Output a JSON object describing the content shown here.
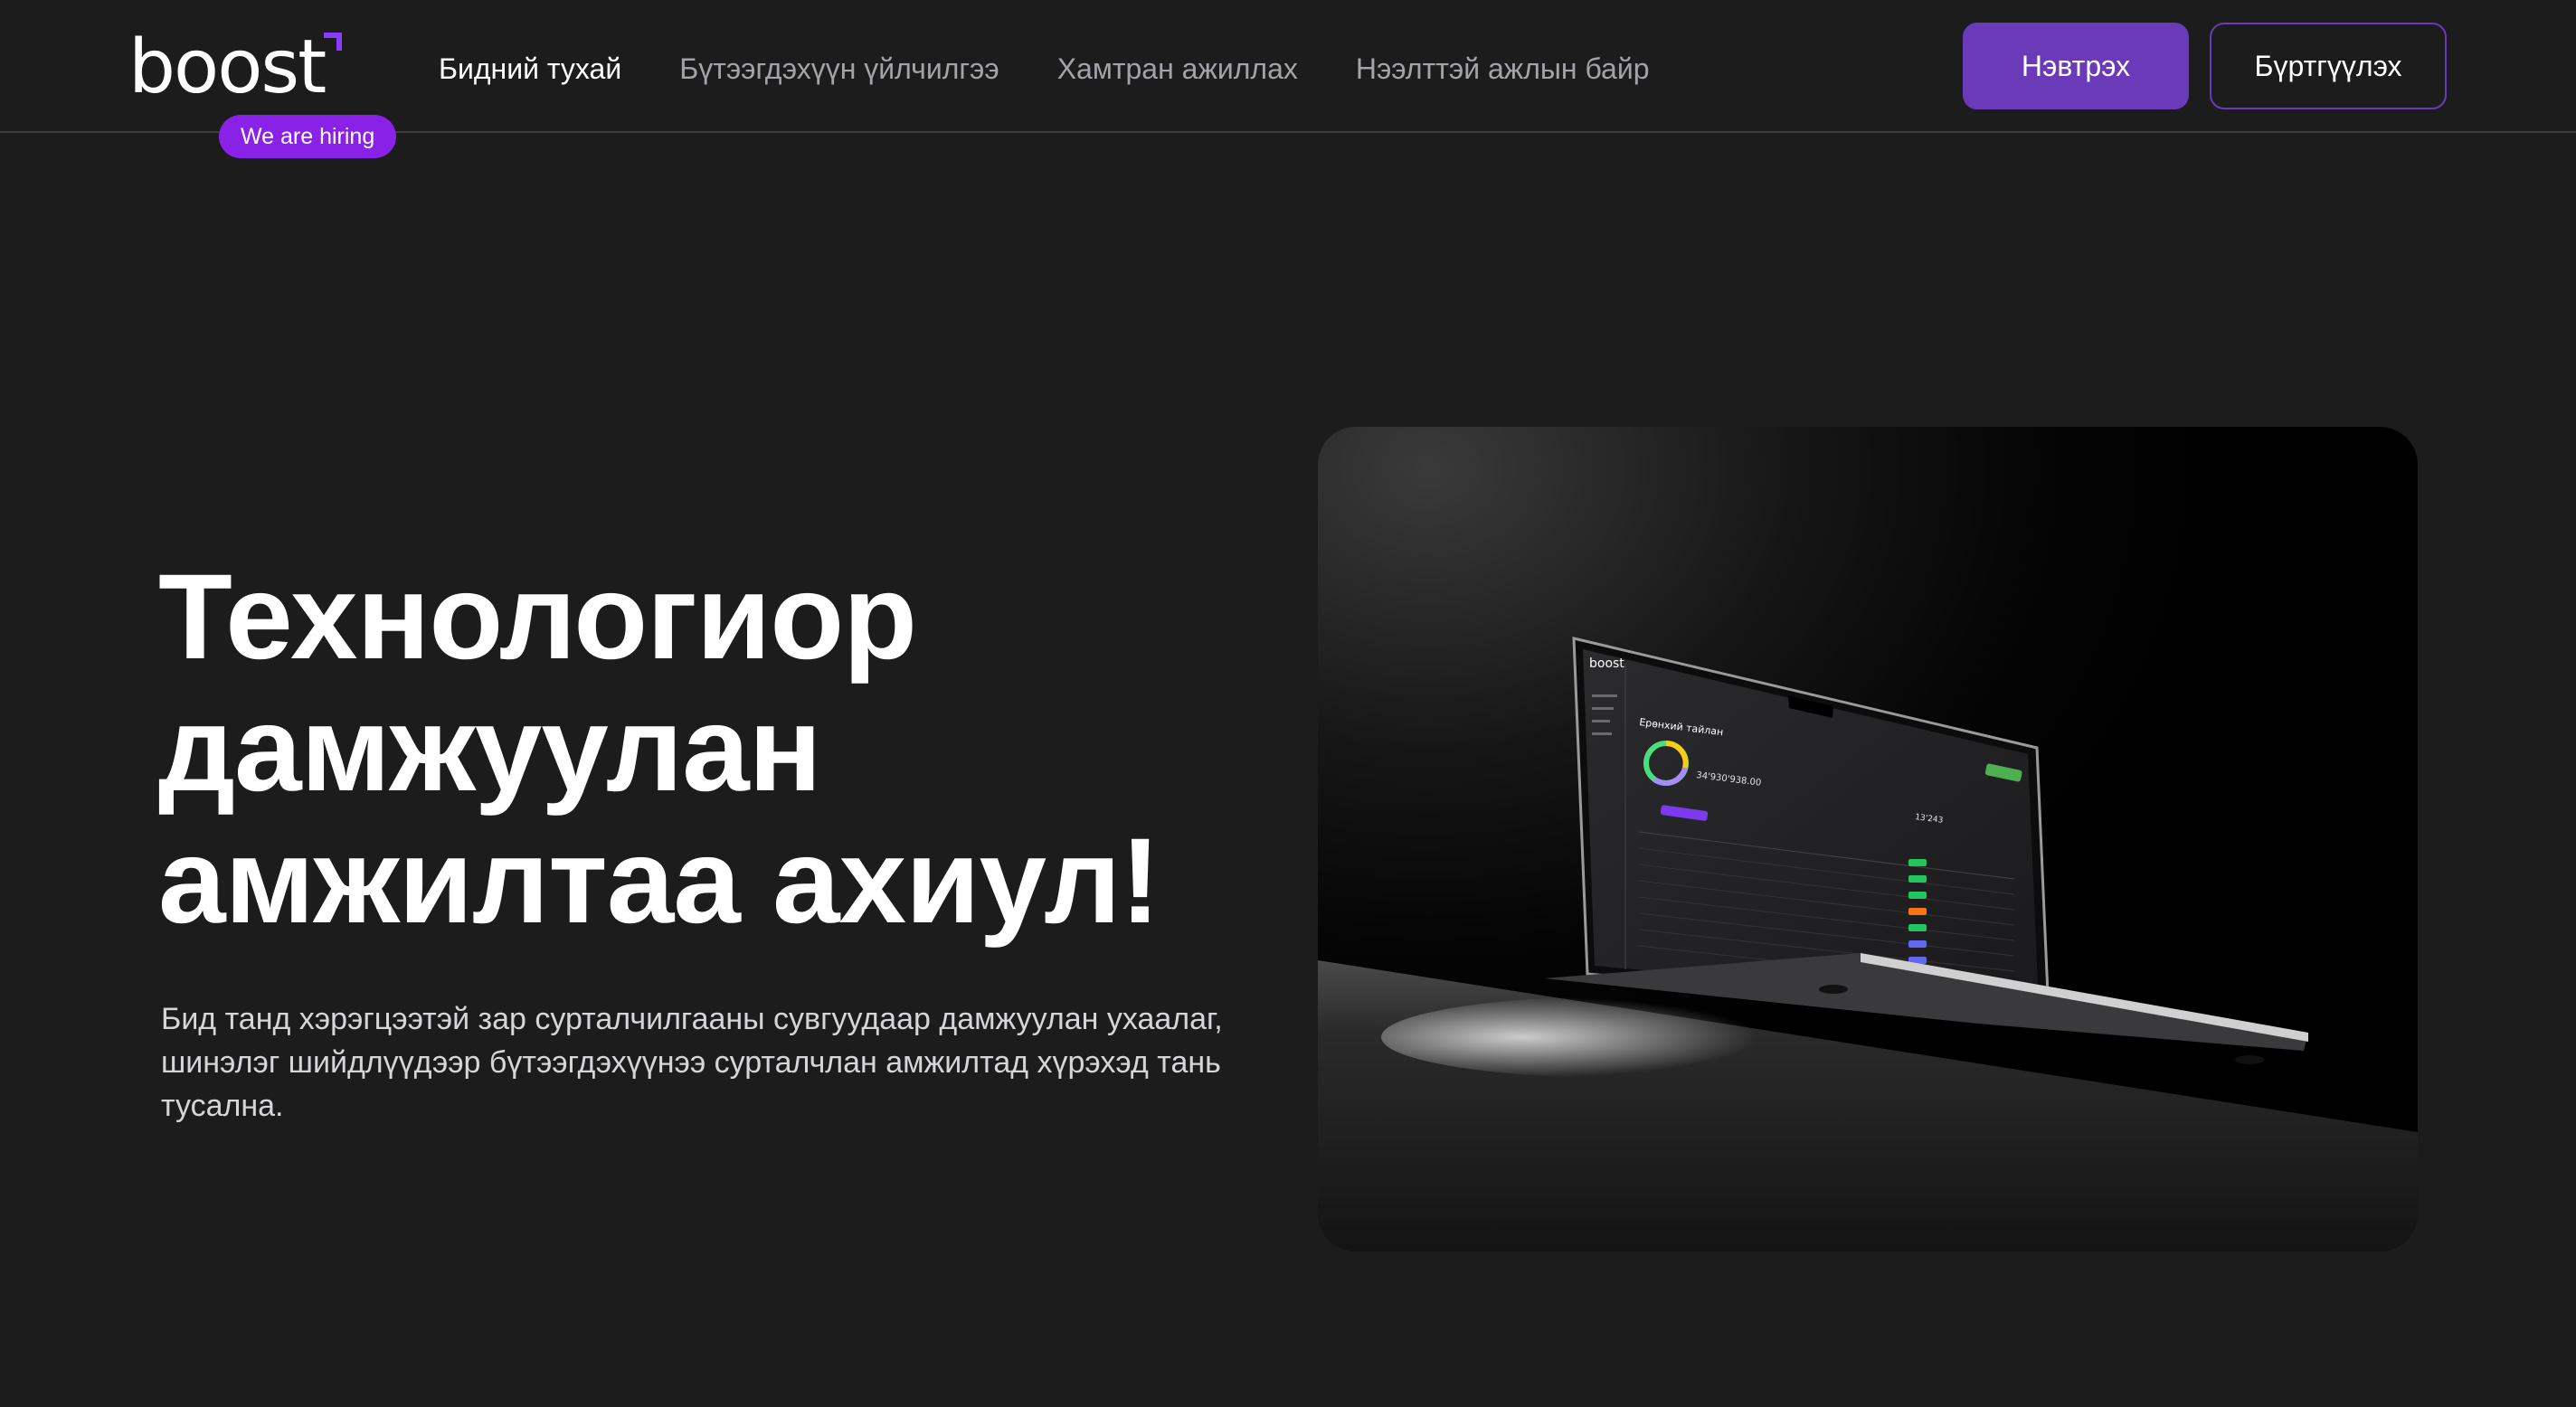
{
  "brand": {
    "logo_text": "boost",
    "hiring_badge": "We are hiring",
    "accent_color": "#6a3ab8",
    "badge_color": "#8a21e6"
  },
  "nav": {
    "items": [
      {
        "label": "Бидний тухай",
        "active": true
      },
      {
        "label": "Бүтээгдэхүүн үйлчилгээ",
        "active": false
      },
      {
        "label": "Хамтран ажиллах",
        "active": false
      },
      {
        "label": "Нээлттэй ажлын байр",
        "active": false
      }
    ]
  },
  "auth": {
    "login_label": "Нэвтрэх",
    "register_label": "Бүртгүүлэх"
  },
  "hero": {
    "title_lines": [
      "Технологиор",
      "дамжуулан",
      "амжилтаа ахиул!"
    ],
    "description": "Бид танд хэрэгцээтэй зар сурталчилгааны сувгуудаар дамжуулан ухаалаг, шинэлэг шийдлүүдээр бүтээгдэхүүнээ сурталчлан амжилтад хүрэхэд тань тусална."
  },
  "laptop_screen": {
    "brand": "boost",
    "heading": "Ерөнхий тайлан",
    "balance": "34'930'938.00",
    "count": "13'243"
  }
}
